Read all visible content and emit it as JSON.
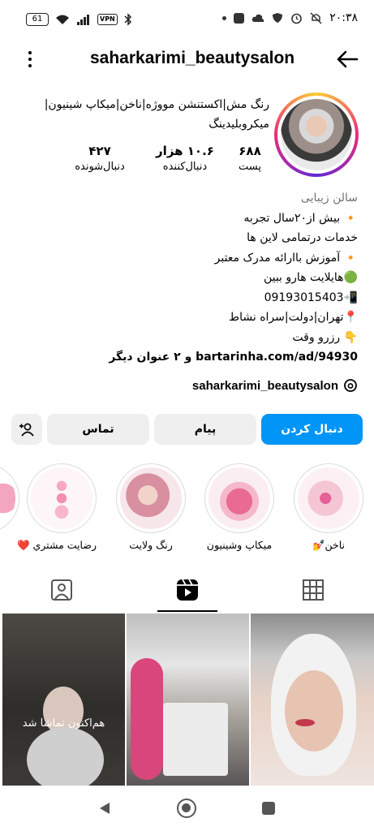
{
  "status_bar": {
    "battery": "61",
    "vpn": "VPN",
    "time": "۲۰:۳۸"
  },
  "header": {
    "username": "saharkarimi_beautysalon"
  },
  "profile": {
    "title_lines": [
      "رنگ مش|اکستنشن مووژه|ناخن|میکاپ شینیون|",
      "میکروبلیدینگ"
    ],
    "stats": {
      "posts": {
        "value": "۶۸۸",
        "label": "پست"
      },
      "followers": {
        "value": "۱۰.۶ هزار",
        "label": "دنبال‌کننده"
      },
      "following": {
        "value": "۴۲۷",
        "label": "دنبال‌شونده"
      }
    },
    "category": "سالن زیبایی",
    "bio_lines": [
      "🔸 بیش از۲۰سال تجربه",
      "خدمات درتمامی لاین ها",
      "🔸 آموزش باارائه مدرک معتبر",
      "🟢هایلایت هارو ببین",
      "📲09193015403",
      "📍تهران|دولت|سراه نشاط",
      "👇 رزرو وقت"
    ],
    "link": "bartarinha.com/ad/94930 و ۲ عنوان دیگر",
    "threads_handle": "saharkarimi_beautysalon"
  },
  "buttons": {
    "follow": "دنبال کردن",
    "message": "پیام",
    "contact": "تماس"
  },
  "highlights": [
    {
      "label": "ناخن💅"
    },
    {
      "label": "میکاپ وشینیون"
    },
    {
      "label": "رنگ ولایت"
    },
    {
      "label": "رضایت مشتري ❤️"
    }
  ],
  "grid": {
    "posts": [
      {
        "overlay": "هم‌اکنون تماشا شد"
      },
      {
        "overlay": ""
      },
      {
        "overlay": ""
      }
    ]
  },
  "colors": {
    "accent": "#0095f6",
    "button_gray": "#efefef",
    "category_gray": "#737373"
  },
  "icons": [
    "more-icon",
    "back-arrow-icon",
    "add-user-icon",
    "tagged-icon",
    "reels-icon",
    "grid-icon",
    "threads-icon",
    "nav-back-icon",
    "nav-home-icon",
    "nav-recents-icon"
  ]
}
